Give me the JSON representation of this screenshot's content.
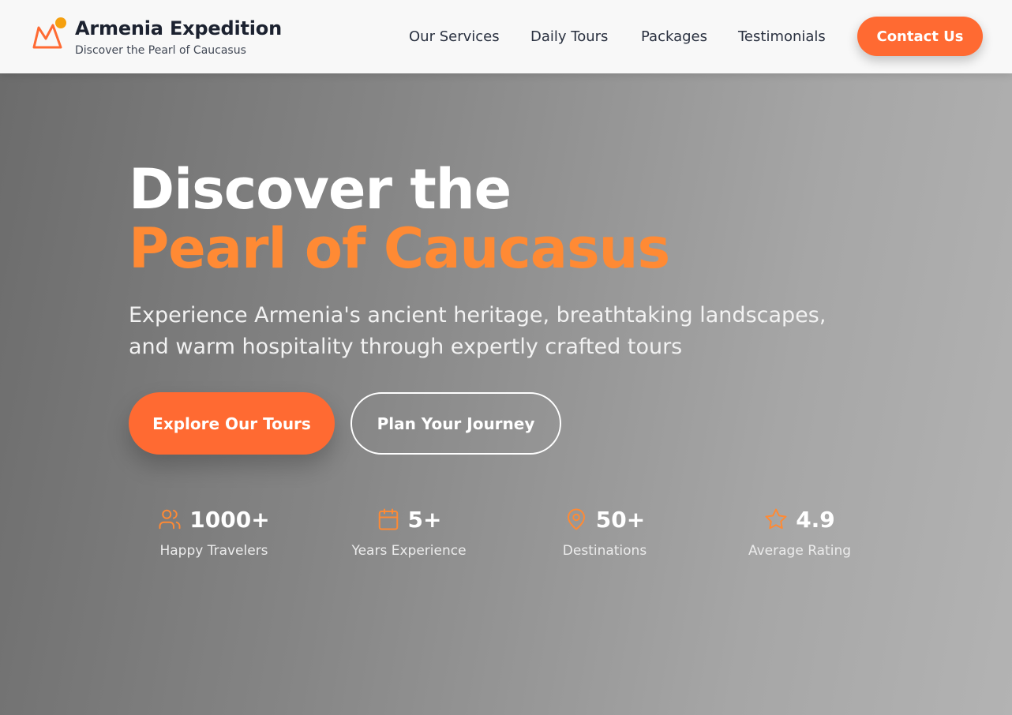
{
  "brand": {
    "title": "Armenia Expedition",
    "subtitle": "Discover the Pearl of Caucasus",
    "logo_icon": "mountain-sun-icon"
  },
  "nav": {
    "items": [
      {
        "label": "Our Services"
      },
      {
        "label": "Daily Tours"
      },
      {
        "label": "Packages"
      },
      {
        "label": "Testimonials"
      }
    ],
    "cta_label": "Contact Us"
  },
  "hero": {
    "headline_line1": "Discover the",
    "headline_line2": "Pearl of Caucasus",
    "subtitle": "Experience Armenia's ancient heritage, breathtaking landscapes, and warm hospitality through expertly crafted tours",
    "primary_button": "Explore Our Tours",
    "secondary_button": "Plan Your Journey"
  },
  "stats": [
    {
      "icon": "users-icon",
      "value": "1000+",
      "label": "Happy Travelers"
    },
    {
      "icon": "calendar-icon",
      "value": "5+",
      "label": "Years Experience"
    },
    {
      "icon": "map-pin-icon",
      "value": "50+",
      "label": "Destinations"
    },
    {
      "icon": "star-icon",
      "value": "4.9",
      "label": "Average Rating"
    }
  ],
  "colors": {
    "accent": "#ff6a32",
    "accent_text": "#ff8a34",
    "header_bg": "#f8f8f8",
    "heading_dark": "#1c2230"
  }
}
